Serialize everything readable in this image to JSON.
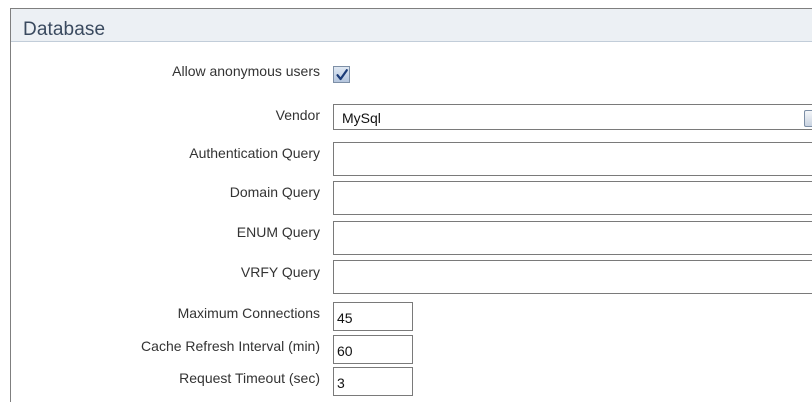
{
  "section": {
    "title": "Database"
  },
  "form": {
    "allow_anonymous": {
      "label": "Allow anonymous users",
      "checked": true
    },
    "vendor": {
      "label": "Vendor",
      "value": "MySql"
    },
    "authentication_query": {
      "label": "Authentication Query",
      "value": ""
    },
    "domain_query": {
      "label": "Domain Query",
      "value": ""
    },
    "enum_query": {
      "label": "ENUM Query",
      "value": ""
    },
    "vrfy_query": {
      "label": "VRFY Query",
      "value": ""
    },
    "maximum_connections": {
      "label": "Maximum Connections",
      "value": "45"
    },
    "cache_refresh_interval": {
      "label": "Cache Refresh Interval (min)",
      "value": "60"
    },
    "request_timeout": {
      "label": "Request Timeout (sec)",
      "value": "3"
    }
  },
  "icons": {
    "checkmark": "checkmark-icon",
    "dropdown": "chevron-down-icon"
  },
  "colors": {
    "header_background": "#ecf0f4",
    "header_text": "#3a4a5f",
    "checkbox_fill": "#b4c5dd",
    "check_color": "#1c3c78"
  }
}
